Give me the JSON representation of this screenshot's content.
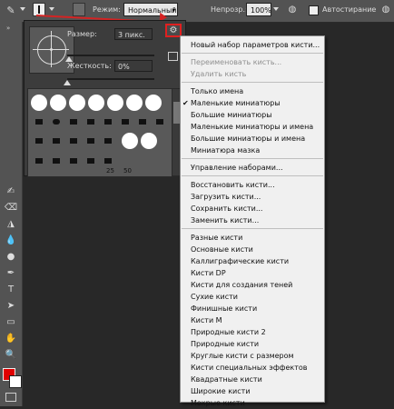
{
  "options_bar": {
    "mode_label": "Режим:",
    "mode_value": "Нормальный",
    "opacity_label": "Непрозр.:",
    "opacity_value": "100%",
    "smoothing_label": "Автостирание"
  },
  "brush_panel": {
    "size_label": "Размер:",
    "size_value": "3 пикс.",
    "hardness_label": "Жесткость:",
    "hardness_value": "0%",
    "size_level": 0.02,
    "hardness_level": 0.0,
    "preset_numbers": [
      "25",
      "50"
    ]
  },
  "menu": {
    "items": [
      {
        "label": "Новый набор параметров кисти...",
        "disabled": false,
        "checked": false
      },
      {
        "label": "Переименовать кисть...",
        "disabled": true,
        "checked": false
      },
      {
        "label": "Удалить кисть",
        "disabled": true,
        "checked": false
      },
      {
        "label": "Только имена",
        "disabled": false,
        "checked": false
      },
      {
        "label": "Маленькие миниатюры",
        "disabled": false,
        "checked": true
      },
      {
        "label": "Большие миниатюры",
        "disabled": false,
        "checked": false
      },
      {
        "label": "Маленькие миниатюры и имена",
        "disabled": false,
        "checked": false
      },
      {
        "label": "Большие миниатюры и имена",
        "disabled": false,
        "checked": false
      },
      {
        "label": "Миниатюра мазка",
        "disabled": false,
        "checked": false
      },
      {
        "label": "Управление наборами...",
        "disabled": false,
        "checked": false
      },
      {
        "label": "Восстановить кисти...",
        "disabled": false,
        "checked": false
      },
      {
        "label": "Загрузить кисти...",
        "disabled": false,
        "checked": false
      },
      {
        "label": "Сохранить кисти...",
        "disabled": false,
        "checked": false
      },
      {
        "label": "Заменить кисти...",
        "disabled": false,
        "checked": false
      },
      {
        "label": "Разные кисти",
        "disabled": false,
        "checked": false
      },
      {
        "label": "Основные кисти",
        "disabled": false,
        "checked": false
      },
      {
        "label": "Каллиграфические кисти",
        "disabled": false,
        "checked": false
      },
      {
        "label": "Кисти DP",
        "disabled": false,
        "checked": false
      },
      {
        "label": "Кисти для создания теней",
        "disabled": false,
        "checked": false
      },
      {
        "label": "Сухие кисти",
        "disabled": false,
        "checked": false
      },
      {
        "label": "Финишные кисти",
        "disabled": false,
        "checked": false
      },
      {
        "label": "Кисти M",
        "disabled": false,
        "checked": false
      },
      {
        "label": "Природные кисти 2",
        "disabled": false,
        "checked": false
      },
      {
        "label": "Природные кисти",
        "disabled": false,
        "checked": false
      },
      {
        "label": "Круглые кисти с размером",
        "disabled": false,
        "checked": false
      },
      {
        "label": "Кисти специальных эффектов",
        "disabled": false,
        "checked": false
      },
      {
        "label": "Квадратные кисти",
        "disabled": false,
        "checked": false
      },
      {
        "label": "Широкие кисти",
        "disabled": false,
        "checked": false
      },
      {
        "label": "Мокрые кисти",
        "disabled": false,
        "checked": false
      }
    ]
  },
  "colors": {
    "accent_red": "#d42323",
    "foreground_color": "#e00000",
    "background_color": "#ffffff"
  },
  "tools": [
    "brush-tool-icon",
    "history-brush-icon",
    "eraser-icon",
    "gradient-icon",
    "blur-icon",
    "dodge-icon",
    "pen-icon",
    "type-icon",
    "path-select-icon",
    "rectangle-icon",
    "hand-icon",
    "zoom-icon"
  ]
}
